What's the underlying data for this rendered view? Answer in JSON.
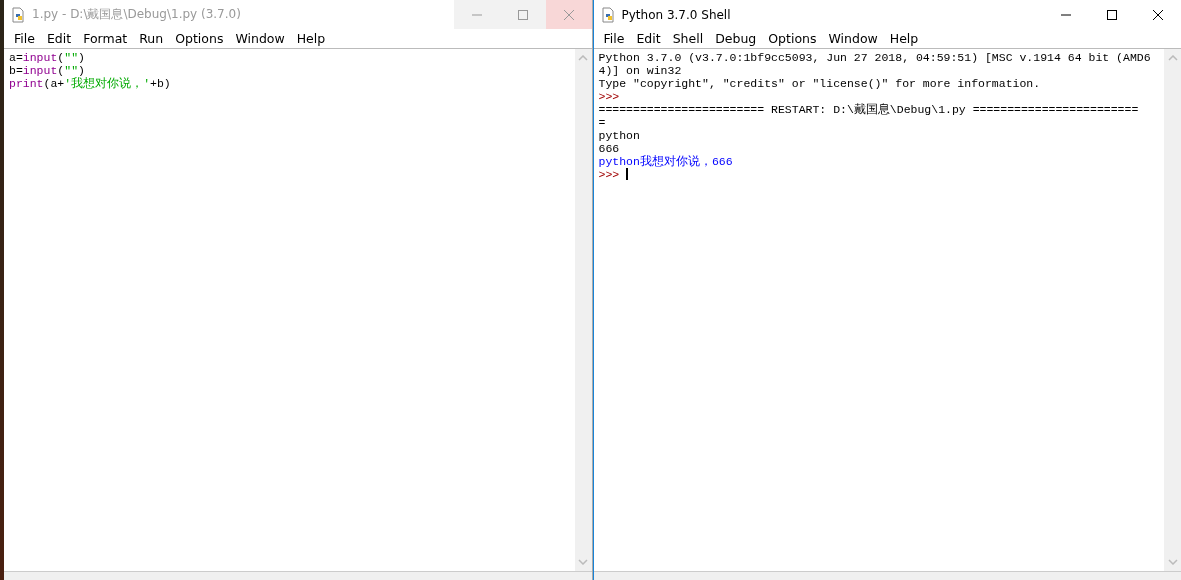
{
  "windows": [
    {
      "title": "1.py - D:\\戴国息\\Debug\\1.py (3.7.0)",
      "active": false,
      "close_hover": true,
      "menu": [
        "File",
        "Edit",
        "Format",
        "Run",
        "Options",
        "Window",
        "Help"
      ],
      "lines": [
        [
          {
            "kind": "plain",
            "text": "a="
          },
          {
            "kind": "builtin",
            "text": "input"
          },
          {
            "kind": "plain",
            "text": "("
          },
          {
            "kind": "string",
            "text": "\"\""
          },
          {
            "kind": "plain",
            "text": ")"
          }
        ],
        [
          {
            "kind": "plain",
            "text": "b="
          },
          {
            "kind": "builtin",
            "text": "input"
          },
          {
            "kind": "plain",
            "text": "("
          },
          {
            "kind": "string",
            "text": "\"\""
          },
          {
            "kind": "plain",
            "text": ")"
          }
        ],
        [
          {
            "kind": "builtin",
            "text": "print"
          },
          {
            "kind": "plain",
            "text": "(a+"
          },
          {
            "kind": "string",
            "text": "'我想对你说，'"
          },
          {
            "kind": "plain",
            "text": "+b)"
          }
        ]
      ],
      "cursor": false
    },
    {
      "title": "Python 3.7.0 Shell",
      "active": true,
      "close_hover": false,
      "menu": [
        "File",
        "Edit",
        "Shell",
        "Debug",
        "Options",
        "Window",
        "Help"
      ],
      "lines": [
        [
          {
            "kind": "plain",
            "text": "Python 3.7.0 (v3.7.0:1bf9cc5093, Jun 27 2018, 04:59:51) [MSC v.1914 64 bit (AMD6"
          }
        ],
        [
          {
            "kind": "plain",
            "text": "4)] on win32"
          }
        ],
        [
          {
            "kind": "plain",
            "text": "Type \"copyright\", \"credits\" or \"license()\" for more information."
          }
        ],
        [
          {
            "kind": "prompt",
            "text": ">>>"
          }
        ],
        [
          {
            "kind": "plain",
            "text": "======================== RESTART: D:\\戴国息\\Debug\\1.py ========================"
          }
        ],
        [
          {
            "kind": "plain",
            "text": "="
          }
        ],
        [
          {
            "kind": "plain",
            "text": "python"
          }
        ],
        [
          {
            "kind": "plain",
            "text": "666"
          }
        ],
        [
          {
            "kind": "stdout",
            "text": "python我想对你说，666"
          }
        ],
        [
          {
            "kind": "prompt",
            "text": ">>> "
          }
        ]
      ],
      "cursor": true
    }
  ]
}
